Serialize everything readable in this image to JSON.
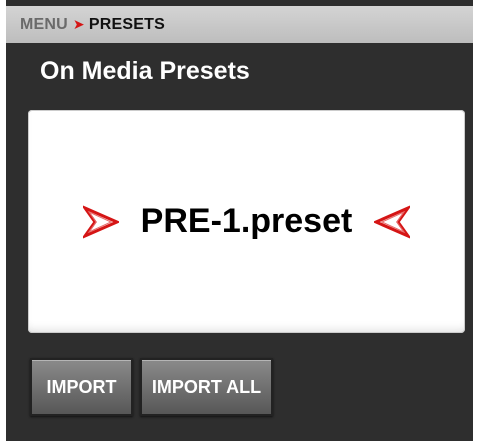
{
  "breadcrumb": {
    "root": "MENU",
    "separator_icon": "chevron-right-icon",
    "current": "PRESETS"
  },
  "page_title": "On Media Presets",
  "preset_selector": {
    "current_value": "PRE-1.preset",
    "prev_icon": "arrow-left-icon",
    "next_icon": "arrow-right-icon"
  },
  "buttons": {
    "import_label": "IMPORT",
    "import_all_label": "IMPORT ALL"
  },
  "colors": {
    "accent": "#d51515",
    "background": "#2e2e2e",
    "header_bar": "#c8c8c8"
  }
}
